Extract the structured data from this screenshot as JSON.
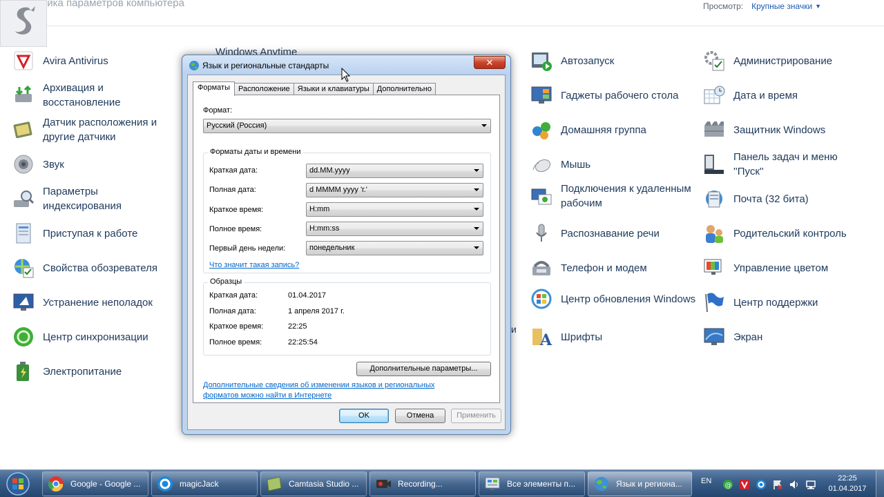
{
  "header": {
    "title": "Настройка параметров компьютера",
    "view_label": "Просмотр:",
    "view_value": "Крупные значки"
  },
  "column1": [
    {
      "label": "Avira Antivirus",
      "icon": "avira-icon"
    },
    {
      "label": "Архивация и восстановление",
      "icon": "backup-icon"
    },
    {
      "label": "Датчик расположения и другие датчики",
      "icon": "location-sensor-icon"
    },
    {
      "label": "Звук",
      "icon": "speaker-icon"
    },
    {
      "label": "Параметры индексирования",
      "icon": "indexing-icon"
    },
    {
      "label": "Приступая к работе",
      "icon": "getting-started-icon"
    },
    {
      "label": "Свойства обозревателя",
      "icon": "internet-options-icon"
    },
    {
      "label": "Устранение неполадок",
      "icon": "troubleshooting-icon"
    },
    {
      "label": "Центр синхронизации",
      "icon": "sync-center-icon"
    },
    {
      "label": "Электропитание",
      "icon": "power-options-icon"
    }
  ],
  "column3": [
    {
      "label": "Автозапуск",
      "icon": "autoplay-icon"
    },
    {
      "label": "Гаджеты рабочего стола",
      "icon": "gadgets-icon"
    },
    {
      "label": "Домашняя группа",
      "icon": "homegroup-icon"
    },
    {
      "label": "Мышь",
      "icon": "mouse-icon"
    },
    {
      "label": "Подключения к удаленным рабочим",
      "icon": "remote-desktop-icon"
    },
    {
      "label": "Распознавание речи",
      "icon": "microphone-icon"
    },
    {
      "label": "Телефон и модем",
      "icon": "phone-modem-icon"
    },
    {
      "label": "Центр обновления Windows",
      "icon": "windows-update-icon"
    },
    {
      "label": "Шрифты",
      "icon": "fonts-icon"
    }
  ],
  "column4": [
    {
      "label": "Администрирование",
      "icon": "admin-tools-icon"
    },
    {
      "label": "Дата и время",
      "icon": "calendar-clock-icon"
    },
    {
      "label": "Защитник Windows",
      "icon": "defender-icon"
    },
    {
      "label": "Панель задач и меню ''Пуск''",
      "icon": "taskbar-icon"
    },
    {
      "label": "Почта (32 бита)",
      "icon": "mail-icon"
    },
    {
      "label": "Родительский контроль",
      "icon": "parental-control-icon"
    },
    {
      "label": "Управление цветом",
      "icon": "color-management-icon"
    },
    {
      "label": "Центр поддержки",
      "icon": "action-center-flag-icon"
    },
    {
      "label": "Экран",
      "icon": "display-icon"
    }
  ],
  "background_partial": {
    "windows_anytime": "Windows Anytime",
    "stray_text": "и"
  },
  "dialog": {
    "title": "Язык и региональные стандарты",
    "close": "✕",
    "tabs": [
      "Форматы",
      "Расположение",
      "Языки и клавиатуры",
      "Дополнительно"
    ],
    "active_tab": "Форматы",
    "format_label": "Формат:",
    "format_value": "Русский (Россия)",
    "datetime_group": "Форматы даты и времени",
    "fields": [
      {
        "label": "Краткая дата:",
        "value": "dd.MM.yyyy"
      },
      {
        "label": "Полная дата:",
        "value": "d MMMM yyyy 'г.'"
      },
      {
        "label": "Краткое время:",
        "value": "H:mm"
      },
      {
        "label": "Полное время:",
        "value": "H:mm:ss"
      },
      {
        "label": "Первый день недели:",
        "value": "понедельник"
      }
    ],
    "help_link": "Что значит такая запись?",
    "samples_group": "Образцы",
    "samples": [
      {
        "label": "Краткая дата:",
        "value": "01.04.2017"
      },
      {
        "label": "Полная дата:",
        "value": "1 апреля 2017 г."
      },
      {
        "label": "Краткое время:",
        "value": "22:25"
      },
      {
        "label": "Полное время:",
        "value": "22:25:54"
      }
    ],
    "more_settings": "Дополнительные параметры...",
    "info_link_line1": "Дополнительные сведения об изменении языков и региональных",
    "info_link_line2": "форматов можно найти в Интернете",
    "ok": "OK",
    "cancel": "Отмена",
    "apply": "Применить"
  },
  "taskbar": {
    "tasks": [
      {
        "label": "Google - Google ...",
        "icon": "chrome-icon"
      },
      {
        "label": "magicJack",
        "icon": "magicjack-icon"
      },
      {
        "label": "Camtasia Studio ...",
        "icon": "camtasia-icon"
      },
      {
        "label": "Recording...",
        "icon": "recording-icon"
      },
      {
        "label": "Все элементы п...",
        "icon": "control-panel-icon"
      },
      {
        "label": "Язык и региона...",
        "icon": "globe-icon"
      }
    ],
    "lang": "EN",
    "time": "22:25",
    "date": "01.04.2017"
  }
}
